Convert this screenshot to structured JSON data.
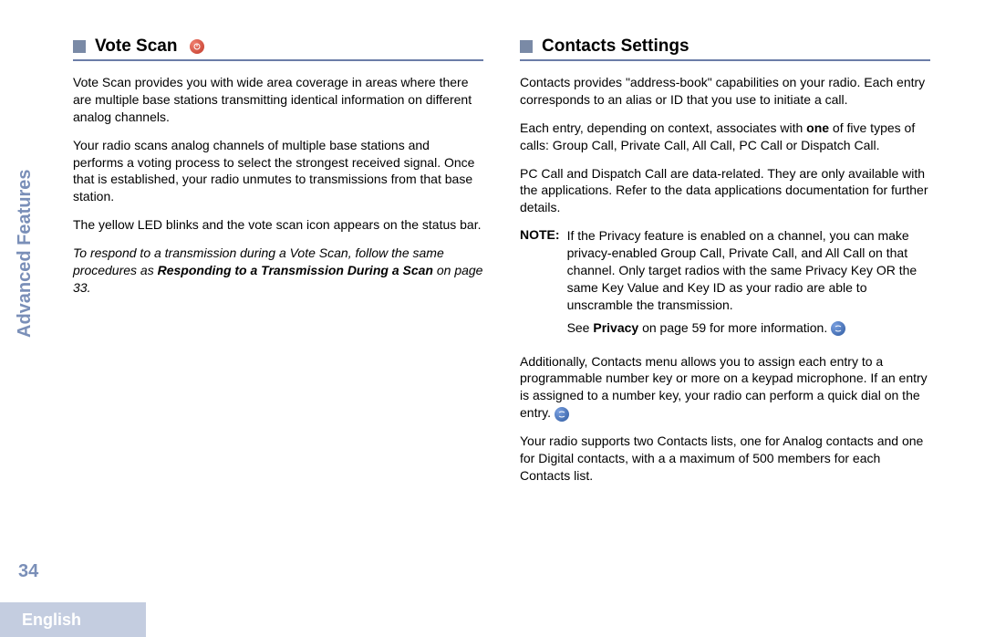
{
  "sidebar": {
    "label": "Advanced Features"
  },
  "pageNumber": "34",
  "language": "English",
  "left": {
    "heading": "Vote Scan",
    "p1": "Vote Scan provides you with wide area coverage in areas where there are multiple base stations transmitting identical information on different analog channels.",
    "p2": "Your radio scans analog channels of multiple base stations and performs a voting process to select the strongest received signal. Once that is established, your radio unmutes to transmissions from that base station.",
    "p3": "The yellow LED blinks and the vote scan icon appears on the status bar.",
    "p4_pre": "To respond to a transmission during a Vote Scan, follow the same procedures as ",
    "p4_bold": "Responding to a Transmission During a Scan",
    "p4_post": " on page 33."
  },
  "right": {
    "heading": "Contacts Settings",
    "p1": "Contacts provides \"address-book\" capabilities on your radio. Each entry corresponds to an alias or ID that you use to initiate a call.",
    "p2_pre": "Each entry, depending on context, associates with ",
    "p2_bold": "one",
    "p2_post": " of five types of calls: Group Call, Private Call, All Call, PC Call or Dispatch Call.",
    "p3": "PC Call and Dispatch Call are data-related. They are only available with the applications. Refer to the data applications documentation for further details.",
    "note_label": "NOTE:",
    "note_body1": "If the Privacy feature is enabled on a channel, you can make privacy-enabled Group Call, Private Call, and All Call on that channel. Only target radios with the same Privacy Key OR the same Key Value and Key ID as your radio are able to unscramble the transmission.",
    "note_body2_pre": "See ",
    "note_body2_bold": "Privacy",
    "note_body2_post": " on page 59 for more information. ",
    "p4": "Additionally, Contacts menu allows you to assign each entry to a programmable number key or more on a keypad microphone. If an entry is assigned to a number key, your radio can perform a quick dial on the entry. ",
    "p5": "Your radio supports two Contacts lists, one for Analog contacts and one for Digital contacts, with a a maximum of 500 members for each Contacts list."
  }
}
